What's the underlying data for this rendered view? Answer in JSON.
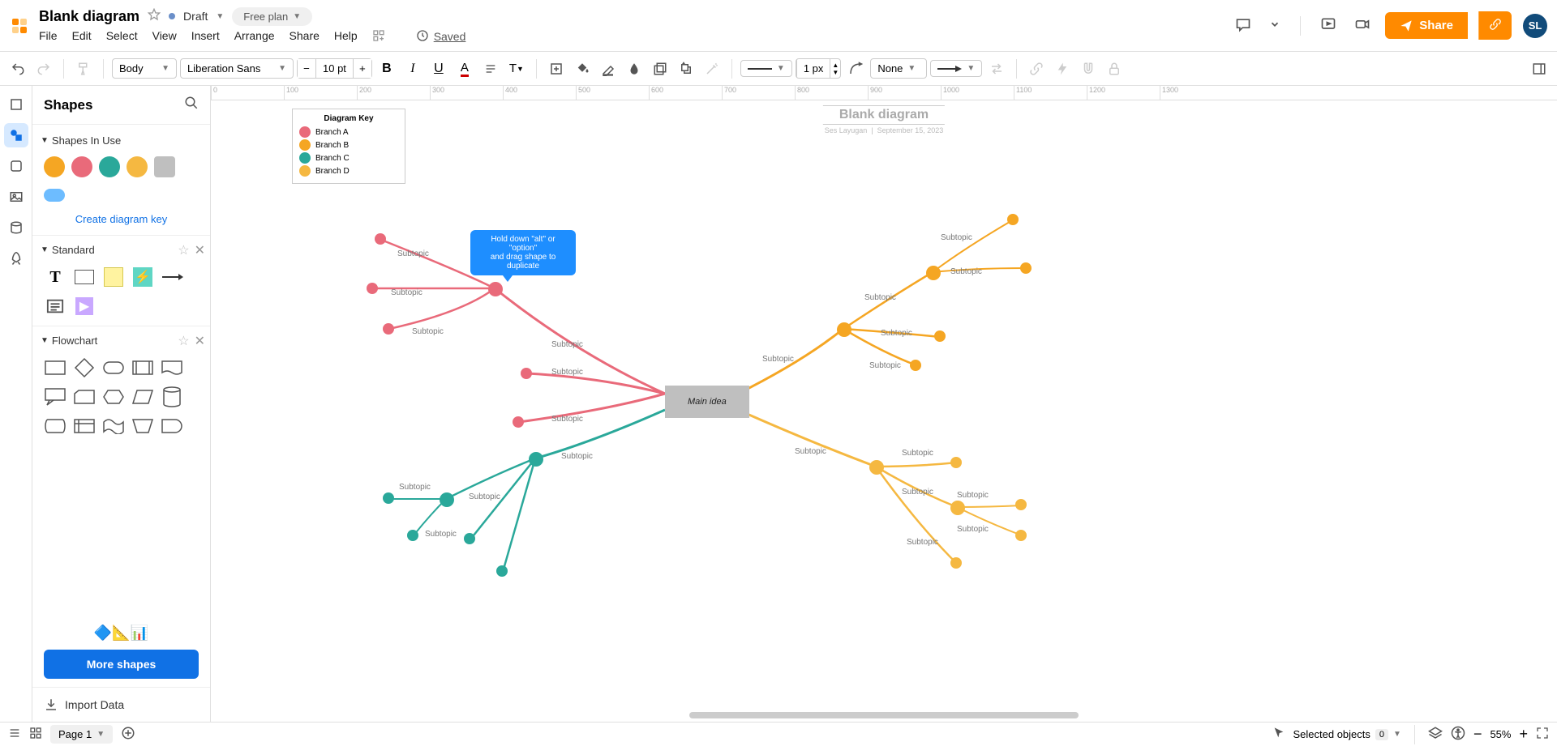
{
  "header": {
    "doc_title": "Blank diagram",
    "draft_label": "Draft",
    "free_plan_label": "Free plan",
    "menu": [
      "File",
      "Edit",
      "Select",
      "View",
      "Insert",
      "Arrange",
      "Share",
      "Help"
    ],
    "saved_label": "Saved",
    "share_btn": "Share",
    "avatar_initials": "SL"
  },
  "toolbar": {
    "style_select": "Body",
    "font_select": "Liberation Sans",
    "font_size": "10 pt",
    "line_width": "1 px",
    "line_style_label": "None"
  },
  "shapes_panel": {
    "title": "Shapes",
    "section_in_use": "Shapes In Use",
    "create_key": "Create diagram key",
    "section_standard": "Standard",
    "section_flowchart": "Flowchart",
    "more_shapes": "More shapes",
    "import_data": "Import Data",
    "colors": {
      "orange": "#f5a623",
      "red": "#e96a7a",
      "teal": "#2aa89a",
      "yellow": "#f5b841",
      "gray": "#bfbfbf"
    }
  },
  "canvas": {
    "title": "Blank diagram",
    "subtitle_author": "Ses Layugan",
    "subtitle_date": "September 15, 2023",
    "tooltip_line1": "Hold down \"alt\" or \"option\"",
    "tooltip_line2": "and drag shape to duplicate",
    "main_idea": "Main idea",
    "subtopic": "Subtopic",
    "key": {
      "title": "Diagram Key",
      "rows": [
        {
          "color": "#e96a7a",
          "label": "Branch A"
        },
        {
          "color": "#f5a623",
          "label": "Branch B"
        },
        {
          "color": "#2aa89a",
          "label": "Branch C"
        },
        {
          "color": "#f5b841",
          "label": "Branch D"
        }
      ]
    },
    "branch_colors": {
      "a": "#e96a7a",
      "b": "#f5a623",
      "c": "#2aa89a",
      "d": "#f5b841"
    }
  },
  "footer": {
    "page_label": "Page 1",
    "selected_objects": "Selected objects",
    "selected_count": "0",
    "zoom": "55%"
  }
}
